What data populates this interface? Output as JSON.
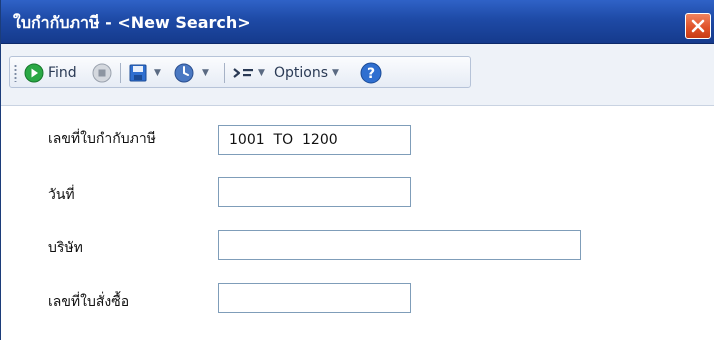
{
  "window": {
    "title": "ใบกำกับภาษี - <New Search>"
  },
  "toolbar": {
    "find_label": "Find",
    "options_label": "Options",
    "icons": [
      "find-icon",
      "stop-icon",
      "save-icon",
      "history-icon",
      "filter-icon",
      "help-icon"
    ]
  },
  "form": {
    "fields": [
      {
        "label": "เลขที่ใบกำกับภาษี",
        "value": "1001  TO  1200"
      },
      {
        "label": "วันที่",
        "value": ""
      },
      {
        "label": "บริษัท",
        "value": ""
      },
      {
        "label": "เลขที่ใบสั่งซื้อ",
        "value": ""
      }
    ]
  },
  "colors": {
    "titlebar": "#1e4aa6",
    "close": "#e0532a",
    "find_green": "#2aa845",
    "help_blue": "#2f6fd0"
  }
}
